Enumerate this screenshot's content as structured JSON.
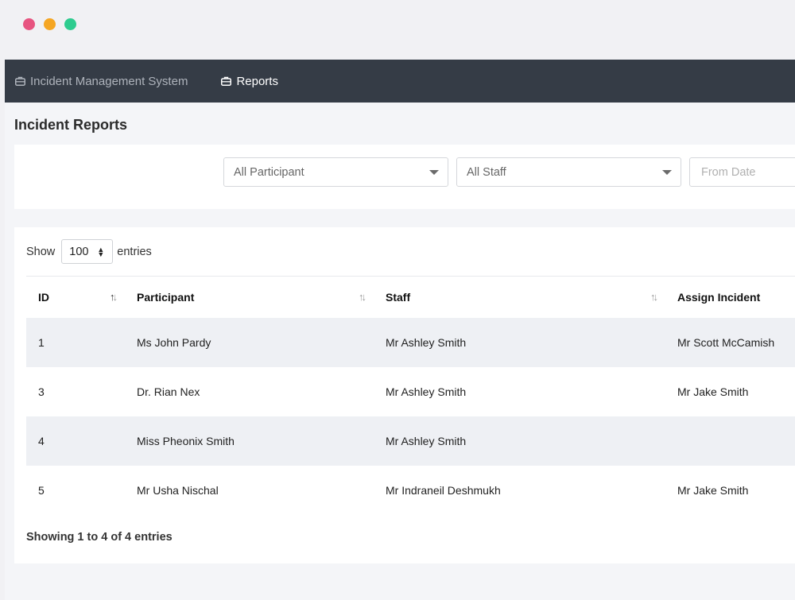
{
  "window": {
    "dots": [
      {
        "name": "close",
        "color": "#e75480"
      },
      {
        "name": "minimize",
        "color": "#f5a623"
      },
      {
        "name": "maximize",
        "color": "#2ecc8f"
      }
    ]
  },
  "navbar": {
    "brand": "Incident Management System",
    "items": [
      {
        "label": "Reports",
        "icon": "briefcase-icon"
      }
    ]
  },
  "page": {
    "title": "Incident Reports"
  },
  "filters": {
    "participant": "All Participant",
    "staff": "All Staff",
    "from_date_placeholder": "From Date"
  },
  "table": {
    "show_label": "Show",
    "entries_value": "100",
    "entries_label": "entries",
    "columns": [
      "ID",
      "Participant",
      "Staff",
      "Assign Incident"
    ],
    "rows": [
      [
        "1",
        "Ms John Pardy",
        "Mr Ashley Smith",
        "Mr Scott McCamish"
      ],
      [
        "3",
        "Dr. Rian Nex",
        "Mr Ashley Smith",
        "Mr Jake Smith"
      ],
      [
        "4",
        "Miss Pheonix Smith",
        "Mr Ashley Smith",
        ""
      ],
      [
        "5",
        "Mr Usha Nischal",
        "Mr Indraneil Deshmukh",
        "Mr Jake Smith"
      ]
    ],
    "info": "Showing 1 to 4 of 4 entries"
  },
  "colors": {
    "navbar_bg": "#353c46",
    "stripe": "#eef0f4",
    "page_bg": "#f4f5f8"
  }
}
